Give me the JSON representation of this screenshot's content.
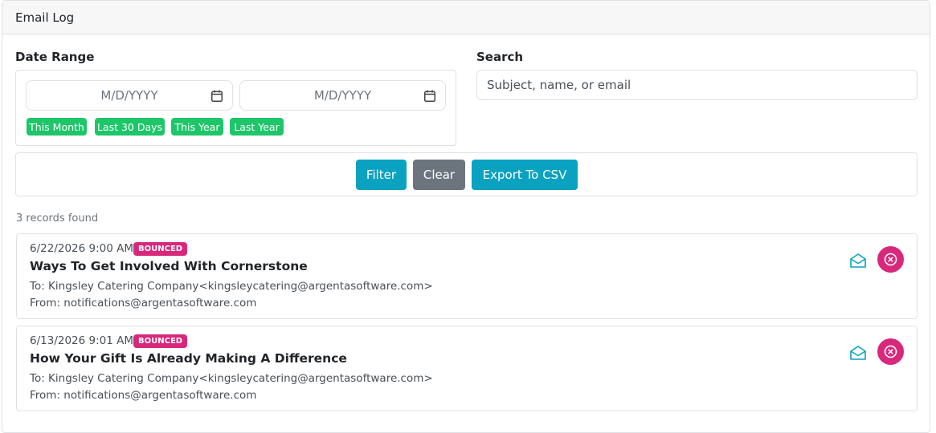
{
  "header": {
    "title": "Email Log"
  },
  "filters": {
    "date_range_label": "Date Range",
    "start_placeholder": "M/D/YYYY",
    "end_placeholder": "M/D/YYYY",
    "presets": [
      "This Month",
      "Last 30 Days",
      "This Year",
      "Last Year"
    ],
    "search_label": "Search",
    "search_placeholder": "Subject, name, or email"
  },
  "actions": {
    "filter": "Filter",
    "clear": "Clear",
    "export": "Export To CSV"
  },
  "records_count": "3 records found",
  "emails": [
    {
      "datetime": "6/22/2026 9:00 AM",
      "status": "BOUNCED",
      "subject": "Ways To Get Involved With Cornerstone",
      "to": "To: Kingsley Catering Company<kingsleycatering@argentasoftware.com>",
      "from": "From: notifications@argentasoftware.com"
    },
    {
      "datetime": "6/13/2026 9:01 AM",
      "status": "BOUNCED",
      "subject": "How Your Gift Is Already Making A Difference",
      "to": "To: Kingsley Catering Company<kingsleycatering@argentasoftware.com>",
      "from": "From: notifications@argentasoftware.com"
    }
  ],
  "colors": {
    "accent": "#0aa2c0",
    "preset_green": "#1ec66a",
    "danger": "#d8287b",
    "secondary": "#6c757d"
  },
  "icons": {
    "calendar": "calendar-icon",
    "open": "envelope-open-icon",
    "remove": "circle-x-icon"
  }
}
